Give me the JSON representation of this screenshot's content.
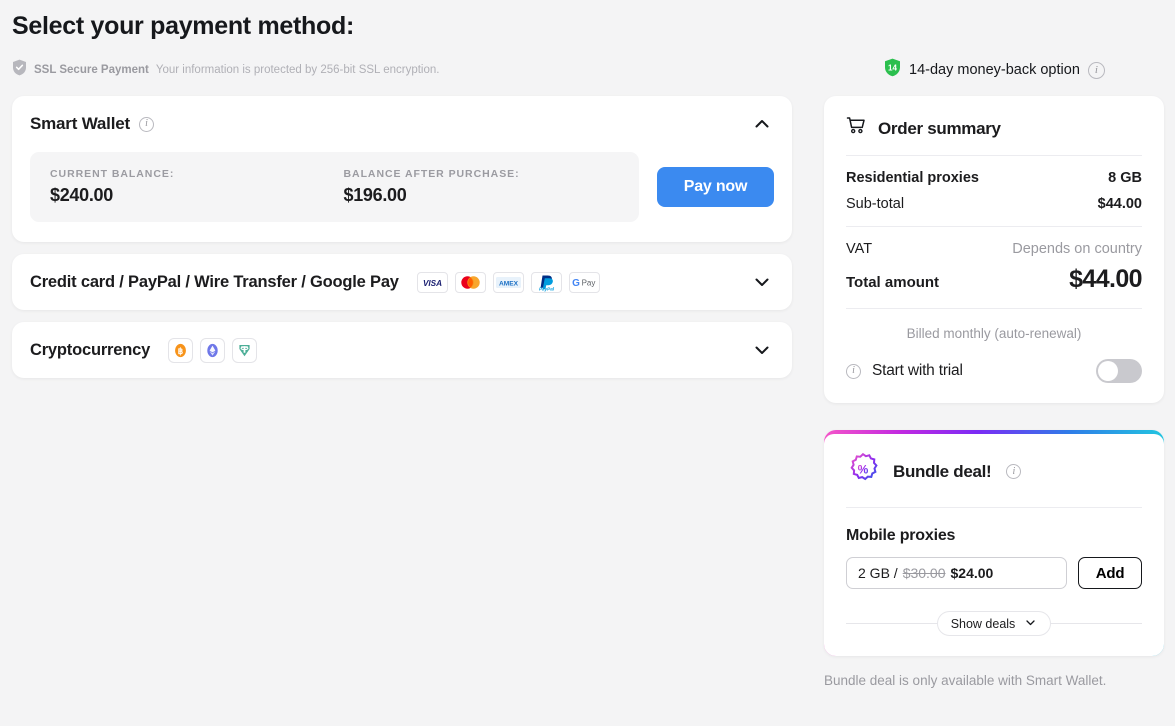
{
  "header": {
    "title": "Select your payment method:",
    "ssl_label": "SSL Secure Payment",
    "ssl_text": "Your information is protected by 256-bit SSL encryption.",
    "moneyback_text": "14-day money-back option",
    "moneyback_badge_number": "14",
    "moneyback_badge_color": "#2bbf4e"
  },
  "wallet": {
    "title": "Smart Wallet",
    "current_balance_label": "CURRENT BALANCE:",
    "current_balance_value": "$240.00",
    "after_purchase_label": "BALANCE AFTER PURCHASE:",
    "after_purchase_value": "$196.00",
    "pay_button": "Pay now",
    "pay_button_color": "#3b8af0",
    "expanded": true
  },
  "methods": [
    {
      "title": "Credit card / PayPal / Wire Transfer / Google Pay",
      "brands": [
        "visa",
        "mastercard",
        "amex",
        "paypal",
        "google-pay"
      ]
    },
    {
      "title": "Cryptocurrency",
      "coins": [
        "bitcoin",
        "ethereum",
        "tether"
      ]
    }
  ],
  "summary": {
    "title": "Order summary",
    "rows": [
      {
        "name": "Residential proxies",
        "value": "8 GB"
      },
      {
        "name": "Sub-total",
        "value": "$44.00"
      },
      {
        "name": "VAT",
        "value": "Depends on country"
      }
    ],
    "total_label": "Total amount",
    "total_value": "$44.00",
    "billed_note": "Billed monthly (auto-renewal)",
    "trial_label": "Start with trial",
    "trial_enabled": false
  },
  "bundle": {
    "title": "Bundle deal!",
    "product": "Mobile proxies",
    "deal_size": "2 GB /",
    "deal_old_price": "$30.00",
    "deal_new_price": "$24.00",
    "add_button": "Add",
    "show_deals": "Show deals",
    "note": "Bundle deal is only available with Smart Wallet.",
    "gradient": [
      "#f455c8",
      "#7b2bf5",
      "#2f7ce8",
      "#22c5e0"
    ]
  }
}
